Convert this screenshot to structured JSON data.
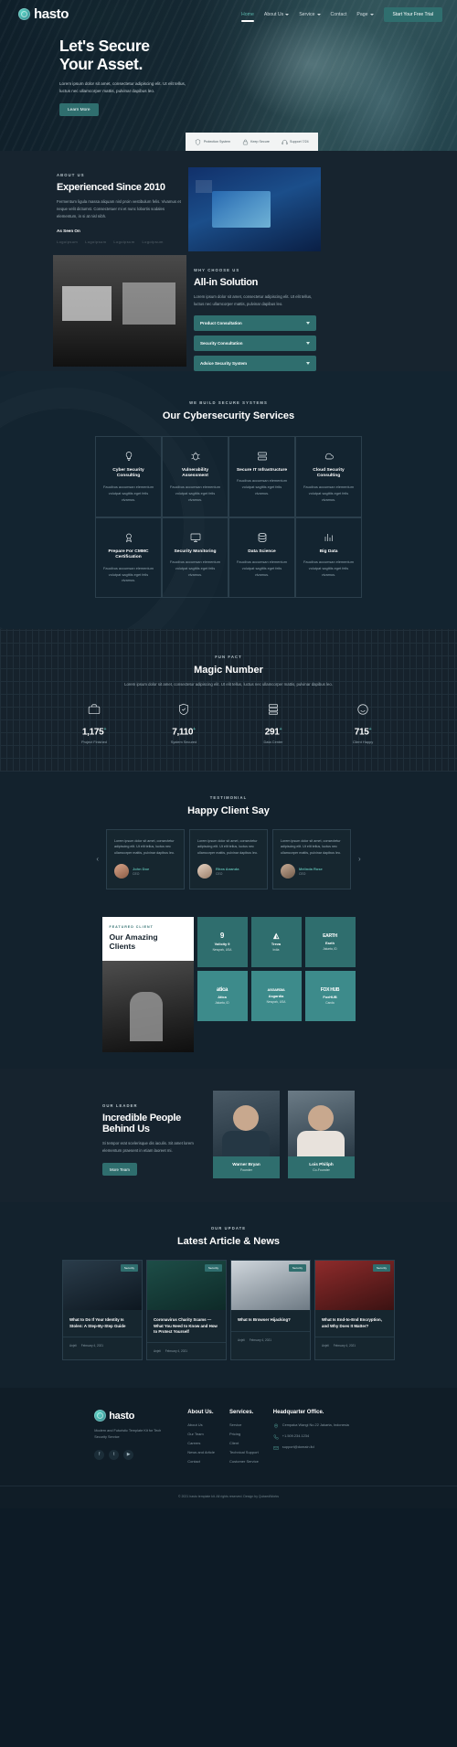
{
  "header": {
    "logo_text": "hasto",
    "nav": [
      {
        "label": "Home",
        "has_caret": false,
        "active": true
      },
      {
        "label": "About Us",
        "has_caret": true,
        "active": false
      },
      {
        "label": "Service",
        "has_caret": true,
        "active": false
      },
      {
        "label": "Contact",
        "has_caret": false,
        "active": false
      },
      {
        "label": "Page",
        "has_caret": true,
        "active": false
      }
    ],
    "cta": "Start Your Free Trial"
  },
  "hero": {
    "title_line1": "Let's Secure",
    "title_line2": "Your Asset.",
    "paragraph": "Lorem ipsum dolor sit amet, consectetur adipiscing elit. Ut elit tellus, luctus nec ullamcorper mattis, pulvinar dapibus leo.",
    "button": "Learn More",
    "features": [
      {
        "label": "Protection System",
        "icon": "shield-icon"
      },
      {
        "label": "Keep Secure",
        "icon": "lock-icon"
      },
      {
        "label": "Support 7/24",
        "icon": "headset-icon"
      }
    ]
  },
  "about": {
    "eyebrow": "ABOUT US",
    "title": "Experienced Since 2010",
    "paragraph": "Fermentum ligula massa aliquam nisl proin vestibulum felis. Vivamus et neque velit dictumst. Consectetuer mi et nunc lobortis sodales elementum, in si at nisl nibh.",
    "seen_title": "As Seen On",
    "seen_logos": [
      "Logoipsum",
      "Logoipsum",
      "Logoipsum",
      "Logoipsum"
    ]
  },
  "why": {
    "eyebrow": "WHY CHOOSE US",
    "title": "All-in Solution",
    "paragraph": "Lorem ipsum dolor sit amet, consectetur adipiscing elit. Ut elit tellus, luctus nec ullamcorper mattis, pulvinar dapibus leo.",
    "accordions": [
      "Product Consultation",
      "Security Consultation",
      "Advice Security System"
    ]
  },
  "services": {
    "eyebrow": "WE BUILD SECURE SYSTEMS",
    "title": "Our Cybersecurity Services",
    "description": "Faucibus accumsan elementum volutpat sagittis eget felis vivamus.",
    "cards": [
      {
        "title": "Cyber Security Consulting",
        "icon": "bulb-icon"
      },
      {
        "title": "Vulnerability Assessment",
        "icon": "bug-icon"
      },
      {
        "title": "Secure IT Infrastructure",
        "icon": "server-icon"
      },
      {
        "title": "Cloud Security Consulting",
        "icon": "cloud-icon"
      },
      {
        "title": "Prepare For CMMC Certification",
        "icon": "certificate-icon"
      },
      {
        "title": "Security Monitoring",
        "icon": "monitor-icon"
      },
      {
        "title": "Data Science",
        "icon": "database-icon"
      },
      {
        "title": "Big Data",
        "icon": "chart-icon"
      }
    ]
  },
  "stats": {
    "eyebrow": "FUN FACT",
    "title": "Magic Number",
    "paragraph": "Lorem ipsum dolor sit amet, consectetur adipiscing elit. Ut elit tellus, luctus nec ullamcorper mattis, pulvinar dapibus leo.",
    "items": [
      {
        "value": "1,175",
        "suffix": "+",
        "label": "Project Finished",
        "icon": "briefcase-icon"
      },
      {
        "value": "7,110",
        "suffix": "+",
        "label": "System Secured",
        "icon": "shield-check-icon"
      },
      {
        "value": "291",
        "suffix": "+",
        "label": "Data Center",
        "icon": "server-stack-icon"
      },
      {
        "value": "715",
        "suffix": "+",
        "label": "Client Happy",
        "icon": "smile-icon"
      }
    ]
  },
  "testimonial": {
    "eyebrow": "TESTIMONIAL",
    "title": "Happy Client Say",
    "items": [
      {
        "quote": "Lorem ipsum dolor sit amet, consectetur adipiscing elit. Ut elit tellus, luctus nec ullamcorper mattis, pulvinar dapibus leo.",
        "name": "John Doe",
        "role": "CEO"
      },
      {
        "quote": "Lorem ipsum dolor sit amet, consectetur adipiscing elit. Ut elit tellus, luctus nec ullamcorper mattis, pulvinar dapibus leo.",
        "name": "Rhea Ananda",
        "role": "CEO"
      },
      {
        "quote": "Lorem ipsum dolor sit amet, consectetur adipiscing elit. Ut elit tellus, luctus nec ullamcorper mattis, pulvinar dapibus leo.",
        "name": "Melinda Rose",
        "role": "CEO"
      }
    ],
    "prev": "‹",
    "next": "›"
  },
  "clients": {
    "eyebrow": "FEATURED CLIENT",
    "title": "Our Amazing Clients",
    "items": [
      {
        "logo": "9",
        "name": "Volicity 9",
        "location": "Newyork, USA",
        "style": "dark"
      },
      {
        "logo": "◭",
        "name": "Treva",
        "location": "India",
        "style": "dark"
      },
      {
        "logo": "EARTH",
        "name": "Earth",
        "location": "Jakarta, ID",
        "style": "dark"
      },
      {
        "logo": "atica",
        "name": "Atica",
        "location": "Jakarta, ID",
        "style": "lite"
      },
      {
        "logo": "ASGARDIA",
        "name": "Asgardia",
        "location": "Newyork, USA",
        "style": "lite"
      },
      {
        "logo": "FOX HUB",
        "name": "FoxHUB",
        "location": "Canda",
        "style": "lite"
      }
    ]
  },
  "team": {
    "eyebrow": "OUR LEADER",
    "title_line1": "Incredible People",
    "title_line2": "Behind Us",
    "paragraph": "Si tempor erat scelerisque dis iaculis. Sit amet lorem elementum praesent in etiam laoreet mi.",
    "button": "More Team",
    "members": [
      {
        "name": "Warner Bryan",
        "role": "Founder"
      },
      {
        "name": "Lois Philiph",
        "role": "Co-Founder"
      }
    ]
  },
  "articles": {
    "eyebrow": "OUR UPDATE",
    "title": "Latest Article & News",
    "items": [
      {
        "tag": "Security",
        "title": "What to Do If Your Identity Is Stolen: A Step-By-Step Guide",
        "author": "Anjeli",
        "date": "February 4, 2021"
      },
      {
        "tag": "Security",
        "title": "Coronavirus Charity Scams — What You Need to Know and How to Protect Yourself",
        "author": "Anjeli",
        "date": "February 4, 2021"
      },
      {
        "tag": "Security",
        "title": "What Is Browser Hijacking?",
        "author": "Anjeli",
        "date": "February 4, 2021"
      },
      {
        "tag": "Security",
        "title": "What Is End-to-End Encryption, and Why Does It Matter?",
        "author": "Anjeli",
        "date": "February 4, 2021"
      }
    ]
  },
  "footer": {
    "logo_text": "hasto",
    "description": "Modern and Futuristic Template Kit for Tech Security Service",
    "social": [
      "facebook-icon",
      "twitter-icon",
      "youtube-icon"
    ],
    "col_about": {
      "heading": "About Us.",
      "links": [
        "About Us",
        "Our Team",
        "Careers",
        "News and Article",
        "Contact"
      ]
    },
    "col_services": {
      "heading": "Services.",
      "links": [
        "Service",
        "Pricing",
        "Client",
        "Technical Support",
        "Customer Service"
      ]
    },
    "col_office": {
      "heading": "Headquarter Office.",
      "address": "Cempaka Wangi No.22 Jakarta, Indonesia",
      "phone": "+1.509.234.1234",
      "email": "support@domain.ltd"
    },
    "copyright": "© 2021 hasto template kit. All rights reserved. Design by QubzedWorks"
  },
  "colors": {
    "accent": "#2f6e6e",
    "accent_light": "#3d8b8b",
    "bg_dark": "#0d1b26",
    "bg_panel": "#13222d",
    "text_muted": "#8496a0",
    "teal_text": "#5bb5ab"
  }
}
